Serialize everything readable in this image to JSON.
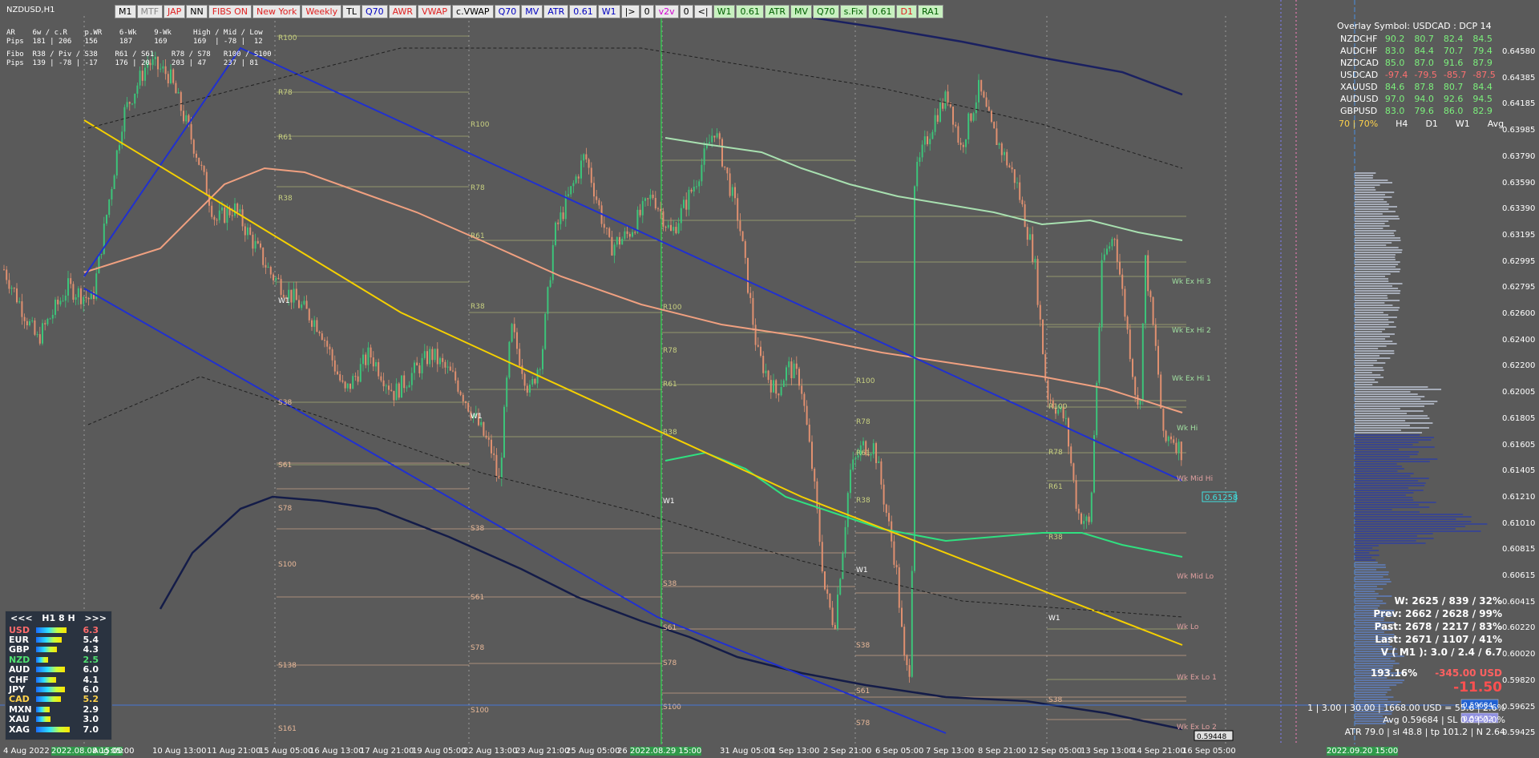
{
  "window": {
    "symbol": "NZDUSD,H1"
  },
  "toolbar": [
    "M1",
    "MTF",
    "JAP",
    "NN",
    "FIBS ON",
    "New York",
    "Weekly",
    "TL",
    "Q70",
    "AWR",
    "VWAP",
    "c.VWAP",
    "Q70",
    "MV",
    "ATR",
    "0.61",
    "W1",
    "|>",
    "0",
    "v2v",
    "0",
    "<|",
    "W1",
    "0.61",
    "ATR",
    "MV",
    "Q70",
    "s.Fix",
    "0.61",
    "D1",
    "RA1"
  ],
  "info_rows": [
    "AR    6w / c.R    p.WR    6-Wk    9-Wk     High / Mid / Low",
    "Pips  181 | 206   156     187     169      169  | -78 |  12",
    "Fibo  R38 / Piv / S38    R61 / S61    R78 / S78   R100 / S100",
    "Pips  139 | -78 | -17    176 | 20     203 | 47    237 | 81"
  ],
  "overlay": {
    "title": "Overlay Symbol: USDCAD : DCP 14",
    "rows": [
      {
        "sym": "NZDCHF",
        "v": [
          "90.2",
          "80.7",
          "82.4",
          "84.5"
        ]
      },
      {
        "sym": "AUDCHF",
        "v": [
          "83.0",
          "84.4",
          "70.7",
          "79.4"
        ]
      },
      {
        "sym": "NZDCAD",
        "v": [
          "85.0",
          "87.0",
          "91.6",
          "87.9"
        ]
      },
      {
        "sym": "USDCAD",
        "v": [
          "-97.4",
          "-79.5",
          "-85.7",
          "-87.5"
        ]
      },
      {
        "sym": "XAUUSD",
        "v": [
          "84.6",
          "87.8",
          "80.7",
          "84.4"
        ]
      },
      {
        "sym": "AUDUSD",
        "v": [
          "97.0",
          "94.0",
          "92.6",
          "94.5"
        ]
      },
      {
        "sym": "GBPUSD",
        "v": [
          "83.0",
          "79.6",
          "86.0",
          "82.9"
        ]
      }
    ],
    "footer": [
      "70 | 70%",
      "H4",
      "D1",
      "W1",
      "Avg"
    ]
  },
  "stats": {
    "w": "W: 2625 / 839 / 32%",
    "prev": "Prev: 2662 / 2628 / 99%",
    "past": "Past: 2678 / 2217 / 83%",
    "last": "Last: 2671 / 1107 / 41%",
    "v": "V ( M1 ): 3.0 / 2.4 / 6.7",
    "pct": "193.16%",
    "usd": "-345.00 USD",
    "big": "-11.50",
    "line1": "1  |  3.00  |  30.00  |  1668.00 USD = 55.6  |  2.6%",
    "line2": "Avg 0.59684  |  SL 0.0  |  0.0%",
    "line3": "ATR 79.0  |  sl 48.8  |  tp 101.2  |  N 2.64"
  },
  "strength": {
    "header": [
      "<<<",
      "H1  8  H",
      ">>>"
    ],
    "rows": [
      {
        "n": "USD",
        "v": "6.3",
        "c": "#ff6b6b"
      },
      {
        "n": "EUR",
        "v": "5.4",
        "c": "#ffffff"
      },
      {
        "n": "GBP",
        "v": "4.3",
        "c": "#ffffff"
      },
      {
        "n": "NZD",
        "v": "2.5",
        "c": "#50e070"
      },
      {
        "n": "AUD",
        "v": "6.0",
        "c": "#ffffff"
      },
      {
        "n": "CHF",
        "v": "4.1",
        "c": "#ffffff"
      },
      {
        "n": "JPY",
        "v": "6.0",
        "c": "#ffffff"
      },
      {
        "n": "CAD",
        "v": "5.2",
        "c": "#ffd24a"
      },
      {
        "n": "MXN",
        "v": "2.9",
        "c": "#ffffff"
      },
      {
        "n": "XAU",
        "v": "3.0",
        "c": "#ffffff"
      },
      {
        "n": "XAG",
        "v": "7.0",
        "c": "#ffffff"
      }
    ]
  },
  "xaxis": [
    "4 Aug 2022",
    "2022.08.08 15:00",
    "Aug 05:00",
    "10 Aug 13:00",
    "11 Aug 21:00",
    "15 Aug 05:00",
    "16 Aug 13:00",
    "17 Aug 21:00",
    "19 Aug 05:00",
    "22 Aug 13:00",
    "23 Aug 21:00",
    "25 Aug 05:00",
    "26",
    "2022.08.29 15:00",
    "31 Aug 05:00",
    "1 Sep 13:00",
    "2 Sep 21:00",
    "6 Sep 05:00",
    "7 Sep 13:00",
    "8 Sep 21:00",
    "12 Sep 05:00",
    "13 Sep 13:00",
    "14 Sep 21:00",
    "16 Sep 05:00",
    "2022.09.20 15:00"
  ],
  "yaxis": [
    "0.64580",
    "0.64385",
    "0.64185",
    "0.63985",
    "0.63790",
    "0.63590",
    "0.63390",
    "0.63195",
    "0.62995",
    "0.62795",
    "0.62600",
    "0.62400",
    "0.62200",
    "0.62005",
    "0.61805",
    "0.61605",
    "0.61405",
    "0.61210",
    "0.61010",
    "0.60815",
    "0.60615",
    "0.60415",
    "0.60220",
    "0.60020",
    "0.59820",
    "0.59625",
    "0.59425"
  ],
  "price_tags": {
    "current": "0.59684",
    "bid": "0.59572",
    "low": "0.59448",
    "level": "0.61258"
  },
  "week_labels": [
    "Wk Ex Hi 3",
    "Wk Ex Hi 2",
    "Wk Ex Hi 1",
    "Wk Hi",
    "Wk Mid Hi",
    "Wk Mid Lo",
    "Wk Lo",
    "Wk Ex Lo 1",
    "Wk Ex Lo 2"
  ],
  "colors": {
    "bg": "#5a5a5a",
    "bull": "#3cc47a",
    "bear": "#e09070",
    "ma1": "#f0a080",
    "ma2": "#1a2050",
    "chan": "#1e2ec8",
    "yellow": "#f5d000"
  }
}
